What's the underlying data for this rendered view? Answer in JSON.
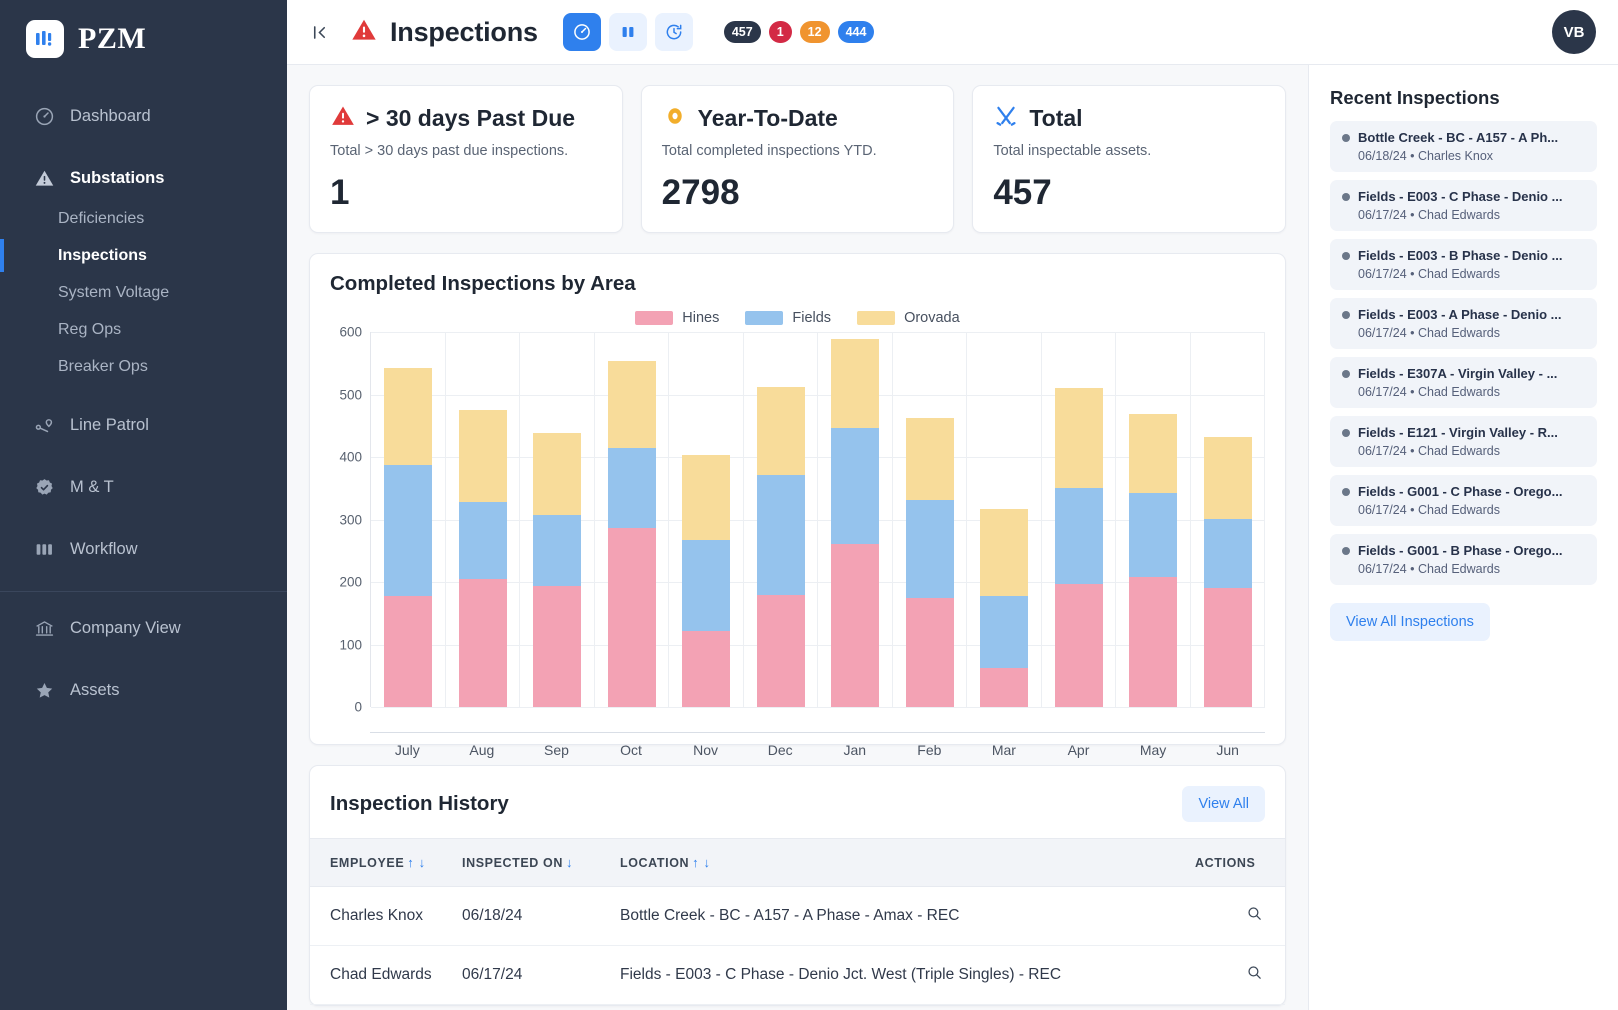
{
  "sidebar": {
    "brand": "PZM",
    "items": [
      {
        "label": "Dashboard",
        "icon": "gauge-icon"
      },
      {
        "label": "Substations",
        "icon": "warning-triangle-icon"
      },
      {
        "label": "Line Patrol",
        "icon": "route-pin-icon"
      },
      {
        "label": "M & T",
        "icon": "badge-check-icon"
      },
      {
        "label": "Workflow",
        "icon": "columns-icon"
      },
      {
        "label": "Company View",
        "icon": "bank-icon"
      },
      {
        "label": "Assets",
        "icon": "star-icon"
      }
    ],
    "sub_items": [
      {
        "label": "Deficiencies"
      },
      {
        "label": "Inspections"
      },
      {
        "label": "System Voltage"
      },
      {
        "label": "Reg Ops"
      },
      {
        "label": "Breaker Ops"
      }
    ],
    "selected_sub": "Inspections"
  },
  "topbar": {
    "collapse_icon": "collapse-left-icon",
    "title": "Inspections",
    "title_icon": "warning-triangle-icon",
    "toggles": [
      {
        "name": "gauge-view",
        "icon": "gauge-icon",
        "active": true
      },
      {
        "name": "columns-view",
        "icon": "columns-icon",
        "active": false
      },
      {
        "name": "history-view",
        "icon": "clock-history-icon",
        "active": false
      }
    ],
    "badges": [
      {
        "value": "457",
        "color": "#2b3649"
      },
      {
        "value": "1",
        "color": "#d32a45"
      },
      {
        "value": "12",
        "color": "#f0942f"
      },
      {
        "value": "444",
        "color": "#2f80ed"
      }
    ],
    "avatar_initials": "VB"
  },
  "stats": [
    {
      "icon": "warning-triangle-icon",
      "title": "> 30 days Past Due",
      "subtitle": "Total > 30 days past due inspections.",
      "value": "1"
    },
    {
      "icon": "eye-icon",
      "title": "Year-To-Date",
      "subtitle": "Total completed inspections YTD.",
      "value": "2798"
    },
    {
      "icon": "tools-icon",
      "title": "Total",
      "subtitle": "Total inspectable assets.",
      "value": "457"
    }
  ],
  "chart_data": {
    "type": "bar",
    "stacked": true,
    "title": "Completed Inspections by Area",
    "xlabel": "",
    "ylabel": "",
    "ylim": [
      0,
      600
    ],
    "yticks": [
      0,
      100,
      200,
      300,
      400,
      500,
      600
    ],
    "grid": true,
    "legend_position": "top-center",
    "categories": [
      "July",
      "Aug",
      "Sep",
      "Oct",
      "Nov",
      "Dec",
      "Jan",
      "Feb",
      "Mar",
      "Apr",
      "May",
      "Jun"
    ],
    "series": [
      {
        "name": "Hines",
        "color": "#f3a2b4",
        "values": [
          178,
          205,
          193,
          286,
          121,
          179,
          261,
          174,
          62,
          197,
          208,
          190
        ]
      },
      {
        "name": "Fields",
        "color": "#95c3ed",
        "values": [
          209,
          123,
          114,
          128,
          147,
          192,
          185,
          157,
          116,
          154,
          135,
          111
        ]
      },
      {
        "name": "Orovada",
        "color": "#f8dc9a",
        "values": [
          156,
          147,
          132,
          139,
          135,
          141,
          143,
          131,
          139,
          160,
          126,
          131
        ]
      }
    ],
    "totals": [
      543,
      475,
      439,
      553,
      403,
      512,
      589,
      462,
      317,
      511,
      469,
      432
    ]
  },
  "history": {
    "title": "Inspection History",
    "view_all_label": "View All",
    "columns": [
      {
        "label": "EMPLOYEE",
        "sort": "↑ ↓"
      },
      {
        "label": "INSPECTED ON",
        "sort": "↓"
      },
      {
        "label": "LOCATION",
        "sort": "↑ ↓"
      },
      {
        "label": "ACTIONS",
        "sort": ""
      }
    ],
    "rows": [
      {
        "employee": "Charles Knox",
        "inspected_on": "06/18/24",
        "location": "Bottle Creek - BC - A157 - A Phase - Amax - REC",
        "action_icon": "search-icon"
      },
      {
        "employee": "Chad Edwards",
        "inspected_on": "06/17/24",
        "location": "Fields - E003 - C Phase - Denio Jct. West (Triple Singles) - REC",
        "action_icon": "search-icon"
      }
    ]
  },
  "recent": {
    "title": "Recent Inspections",
    "view_all_label": "View All Inspections",
    "items": [
      {
        "name": "Bottle Creek - BC - A157 - A Ph...",
        "meta": "06/18/24 • Charles Knox"
      },
      {
        "name": "Fields - E003 - C Phase - Denio ...",
        "meta": "06/17/24 • Chad Edwards"
      },
      {
        "name": "Fields - E003 - B Phase - Denio ...",
        "meta": "06/17/24 • Chad Edwards"
      },
      {
        "name": "Fields - E003 - A Phase - Denio ...",
        "meta": "06/17/24 • Chad Edwards"
      },
      {
        "name": "Fields - E307A - Virgin Valley - ...",
        "meta": "06/17/24 • Chad Edwards"
      },
      {
        "name": "Fields - E121 - Virgin Valley - R...",
        "meta": "06/17/24 • Chad Edwards"
      },
      {
        "name": "Fields - G001 - C Phase - Orego...",
        "meta": "06/17/24 • Chad Edwards"
      },
      {
        "name": "Fields - G001 - B Phase - Orego...",
        "meta": "06/17/24 • Chad Edwards"
      }
    ]
  },
  "colors": {
    "accent": "#2f80ed",
    "sidebar_bg": "#2b3649",
    "danger": "#d32a45",
    "warning": "#f0942f",
    "hines": "#f3a2b4",
    "fields": "#95c3ed",
    "orovada": "#f8dc9a"
  }
}
